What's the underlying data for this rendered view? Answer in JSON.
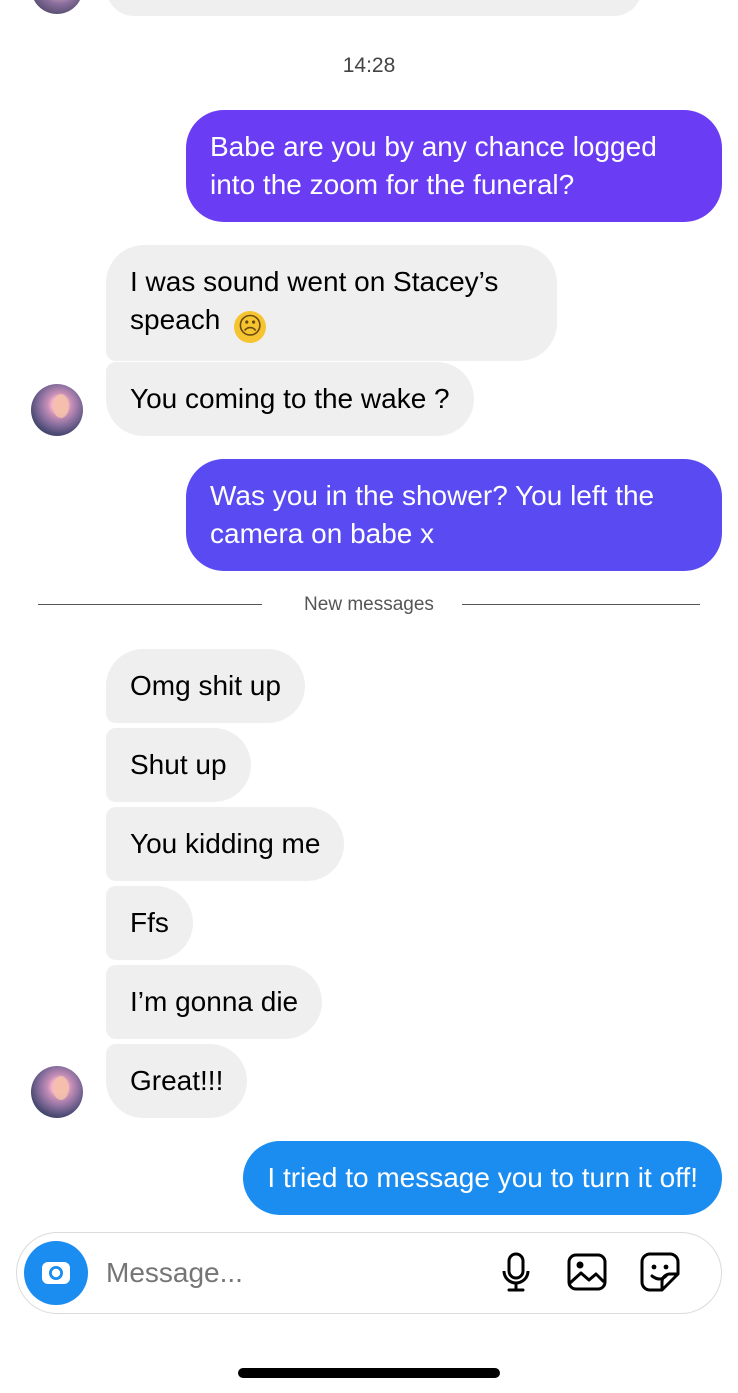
{
  "timestamp": "14:28",
  "divider_label": "New messages",
  "messages": {
    "m1": "Babe are you by any chance logged into the zoom for the funeral?",
    "m2": "I was sound went on Stacey’s speach",
    "m2_emoji": "☹",
    "m3": "You coming to the wake ?",
    "m4": "Was you in the shower? You left the camera on babe x",
    "m5": "Omg shit up",
    "m6": "Shut up",
    "m7": "You kidding me",
    "m8": "Ffs",
    "m9": "I’m gonna die",
    "m10": "Great!!!",
    "m11": "I tried to message you to turn it off!"
  },
  "composer": {
    "placeholder": "Message..."
  },
  "icons": {
    "camera": "camera-icon",
    "mic": "microphone-icon",
    "gallery": "gallery-icon",
    "sticker": "sticker-icon"
  },
  "colors": {
    "sent_purple": "#6a3cf4",
    "sent_indigo": "#5a4af2",
    "sent_blue": "#1b8cf0",
    "received_gray": "#efefef"
  }
}
